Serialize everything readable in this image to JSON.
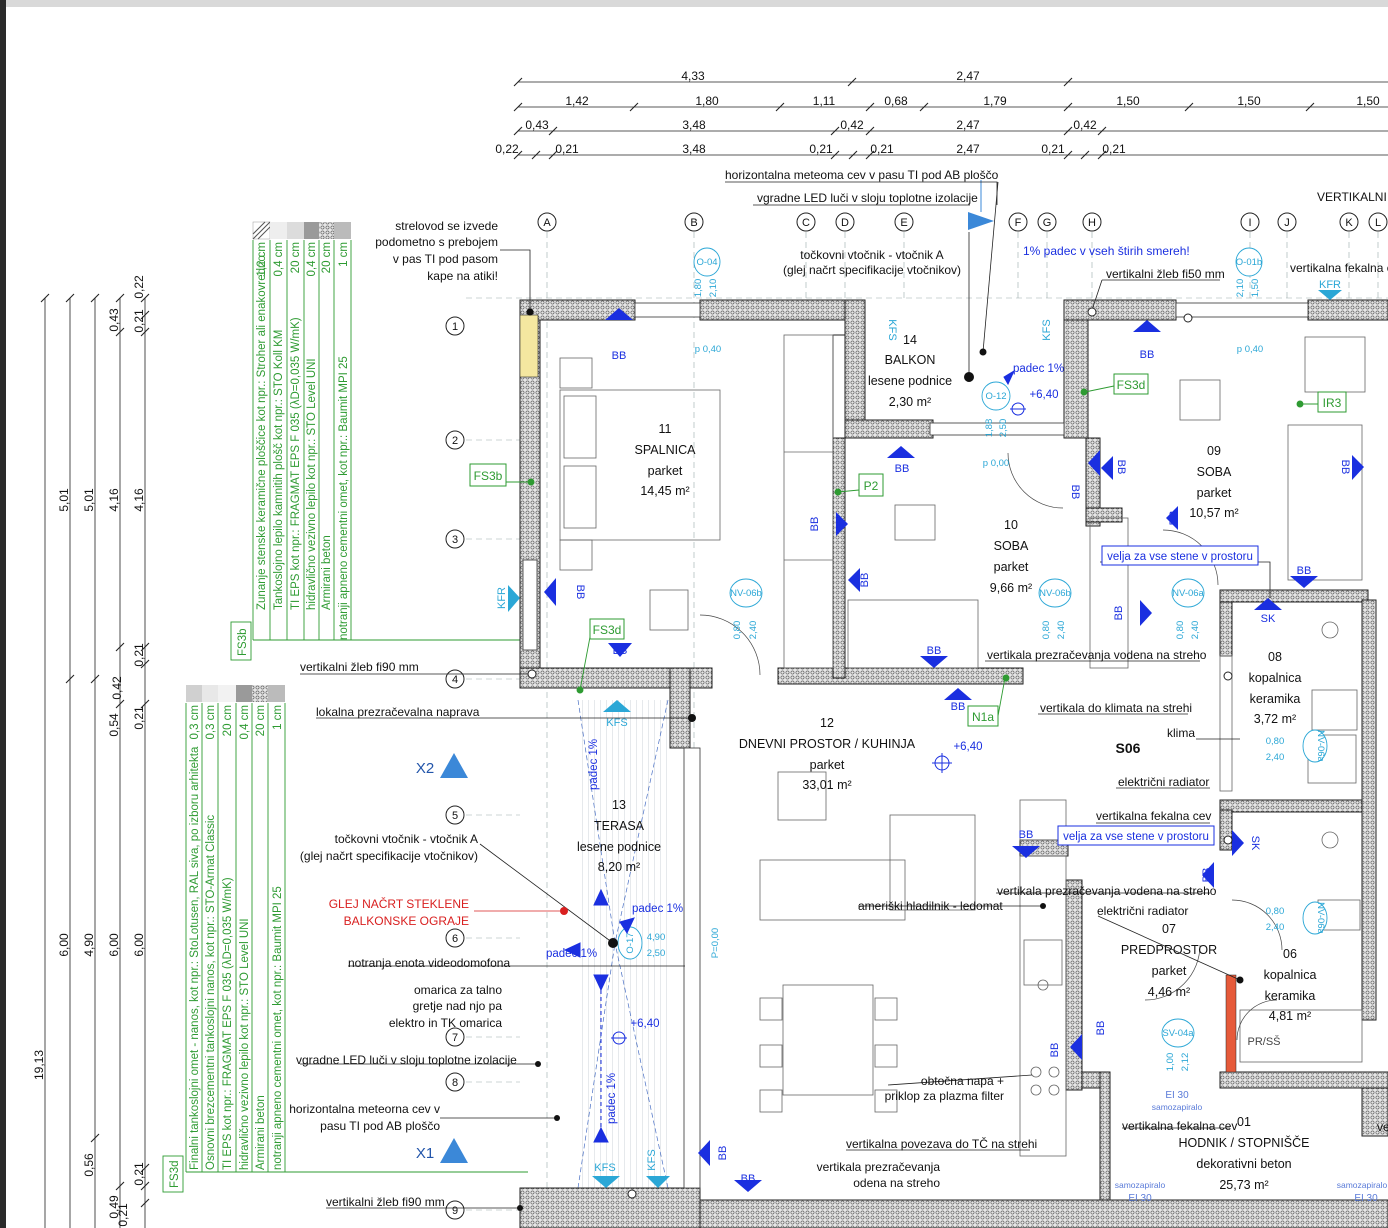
{
  "dimensions": {
    "row1": [
      "4,33",
      "2,47"
    ],
    "row2": [
      "1,42",
      "1,80",
      "1,11",
      "0,68",
      "1,79",
      "1,50",
      "1,50",
      "1,50"
    ],
    "row3": [
      "0,43",
      "3,48",
      "0,42",
      "2,47",
      "0,42"
    ],
    "row4": [
      "0,22",
      "0,21",
      "3,48",
      "0,21",
      "0,21",
      "2,47",
      "0,21",
      "0,21"
    ],
    "left_total": "19,13",
    "left_col2": [
      "5,01",
      "6,00"
    ],
    "left_col3": [
      "5,01",
      "4,90",
      "0,56"
    ],
    "left_col4": [
      "0,43",
      "4,16",
      "0,54",
      "6,00",
      "0,49"
    ],
    "left_col5": [
      "0,22",
      "0,21",
      "4,16",
      "0,21",
      "0,42",
      "0,21",
      "6,00",
      "0,21",
      "0,21"
    ]
  },
  "axes": {
    "columns": [
      "A",
      "B",
      "C",
      "D",
      "E",
      "F",
      "G",
      "H",
      "I",
      "J",
      "K",
      "L"
    ],
    "rows": [
      "1",
      "2",
      "3",
      "4",
      "5",
      "6",
      "7",
      "8",
      "9"
    ]
  },
  "layers": {
    "fs3b": [
      "Zunanje stenske keramične ploščice kot npr.: Stroher ali enakovredno",
      "Tankoslojno lepilo kamnitih plošč kot npr.: STO Koll KM",
      "TI EPS kot npr.: FRAGMAT EPS F 035 (λD=0,035 W/mK)",
      "hidravlično vezivno lepilo kot npr.: STO Level UNI",
      "Armirani beton",
      "notranji apneno cementni omet, kot npr.: Baumit MPI 25"
    ],
    "fs3b_thk": [
      "1,2 cm",
      "0,4 cm",
      "20 cm",
      "0,4 cm",
      "20 cm",
      "1 cm"
    ],
    "fs3d": [
      "Finalni tankoslojni omet - nanos, kot npr.: StoLotusen, RAL siva, po izboru arhitekta",
      "Osnovni brezcementni tankoslojni nanos, kot npr.: STO-Armat Classic",
      "TI EPS kot npr.: FRAGMAT EPS F 035 (λD=0,035 W/mK)",
      "hidravlično vezivno lepilo kot npr.: STO Level UNI",
      "Armirani beton",
      "notranji apneno cementni omet, kot npr.: Baumit MPI 25"
    ],
    "fs3d_thk": [
      "0,3 cm",
      "0,3 cm",
      "20 cm",
      "0,4 cm",
      "20 cm",
      "1 cm"
    ],
    "tag_fs3b": "FS3b",
    "tag_fs3d": "FS3d"
  },
  "rooms": [
    {
      "num": "11",
      "name": "SPALNICA",
      "floor": "parket",
      "area": "14,45 m²"
    },
    {
      "num": "14",
      "name": "BALKON",
      "floor": "lesene podnice",
      "area": "2,30 m²"
    },
    {
      "num": "10",
      "name": "SOBA",
      "floor": "parket",
      "area": "9,66 m²"
    },
    {
      "num": "09",
      "name": "SOBA",
      "floor": "parket",
      "area": "10,57 m²"
    },
    {
      "num": "08",
      "name": "kopalnica",
      "floor": "keramika",
      "area": "3,72 m²"
    },
    {
      "num": "12",
      "name": "DNEVNI PROSTOR / KUHINJA",
      "floor": "parket",
      "area": "33,01 m²"
    },
    {
      "num": "13",
      "name": "TERASA",
      "floor": "lesene podnice",
      "area": "8,20 m²"
    },
    {
      "num": "07",
      "name": "PREDPROSTOR",
      "floor": "parket",
      "area": "4,46 m²"
    },
    {
      "num": "06",
      "name": "kopalnica",
      "floor": "keramika",
      "area": "4,81 m²"
    },
    {
      "num": "01",
      "name": "HODNIK / STOPNIŠČE",
      "floor": "dekorativni beton",
      "area": "25,73 m²"
    }
  ],
  "notes": {
    "strelovod": [
      "strelovod se izvede",
      "podometno s prebojem",
      "v pas TI pod pasom",
      "kape na atiki!"
    ],
    "hor_meteorna": "horizontalna meteoma cev v pasu TI pod AB ploščo",
    "led_top": "vgradne LED luči v sloju toplotne izolacije",
    "vtocnik_top": [
      "točkovni vtočnik - vtočnik A",
      "(glej načrt specifikacije vtočnikov)"
    ],
    "padec_smeri": "1% padec v vseh štirih smereh!",
    "zleb50": "vertikalni žleb fi50 mm",
    "vertikalni_top": "VERTIKALNI",
    "fekalna_top": "vertikalna fekalna c",
    "zleb90_a": "vertikalni žleb fi90 mm",
    "lokalna": "lokalna prezračevalna naprava",
    "prezr_streho": "vertikala prezračevanja vodena na streho",
    "klimat": "vertikala do klimata na strehi",
    "klima": "klima",
    "rad1": "električni radiator",
    "fekalna_mid": "vertikalna fekalna cev",
    "velja_1": "velja za vse stene v prostoru",
    "velja_2": "velja za vse stene v prostoru",
    "vtocnik_terasa": [
      "točkovni vtočnik - vtočnik A",
      "(glej načrt specifikacije vtočnikov)"
    ],
    "glej_ograje": [
      "GLEJ NAČRT STEKLENE",
      "BALKONSKE OGRAJE"
    ],
    "hladilnik": "ameriški hladilnik - ledomat",
    "prezr_streho2": "vertikala prezračevanja vodena na streho",
    "rad2": "električni radiator",
    "videodomofon": "notranja enota videodomofona",
    "omarica": [
      "omarica za talno",
      "gretje nad njo pa",
      "elektro in TK omarica"
    ],
    "led_bottom": "vgradne LED luči v sloju toplotne izolacije",
    "hor_meteorna_b": [
      "horizontalna meteorna cev v",
      "pasu TI pod AB ploščo"
    ],
    "napa": [
      "obtočna napa +",
      "priklop za plazma filter"
    ],
    "povezava_tc": "vertikalna povezava do TČ na strehi",
    "prezr_odena": [
      "vertikala prezračevanja",
      "odena na streho"
    ],
    "fekalna_low": "vertikalna fekalna cev",
    "zleb90_b": "vertikalni žleb fi90 mm",
    "ve_cut": "ve",
    "unit": "S06"
  },
  "tags": {
    "bb": "BB",
    "kfr": "KFR",
    "kfs": "KFS",
    "fs3d": "FS3d",
    "ir3": "IR3",
    "p2": "P2",
    "n1a": "N1a",
    "sk": "SK",
    "prss": "PR/SŠ",
    "ei30": "EI 30",
    "samozapiralo": "samozapiralo",
    "x1": "X1",
    "x2": "X2",
    "o04": "O-04",
    "o01b": "O-01b",
    "o12": "O-12",
    "o17": "O-17",
    "nv06b": "NV-06b",
    "nv06a": "NV-06a",
    "sv04a": "SV-04a",
    "p040": "p 0,40",
    "p000": "p 0,00",
    "p000v": "P=0,00",
    "padec1": "padec 1%",
    "lev640": "+6,40",
    "v180": "1,80",
    "v210": "2,10",
    "v150": "1,50",
    "v080": "0,80",
    "v240": "2,40",
    "v100": "1,00",
    "v212": "2,12",
    "v490": "4,90",
    "v250": "2,50",
    "v250b": "2,50",
    "v188": "1,88"
  },
  "colors": {
    "line": "#222222",
    "blue_mark": "#1a2fe0",
    "cyan_tag": "#2ba7d6",
    "green_tag": "#2e9b32",
    "red_note": "#d92020",
    "wall_fill": "#8c8c8c"
  }
}
